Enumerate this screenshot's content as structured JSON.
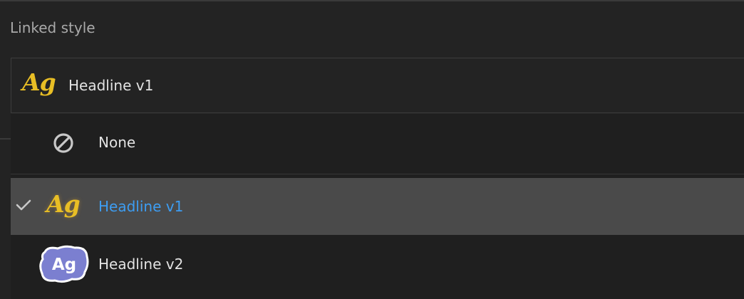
{
  "section": {
    "label": "Linked style"
  },
  "dropdown": {
    "icon": "Ag",
    "selected_value": "Headline v1"
  },
  "menu": {
    "items": [
      {
        "label": "None",
        "icon": "no-entry-icon",
        "selected": false
      },
      {
        "label": "Headline v1",
        "icon": "Ag",
        "selected": true
      },
      {
        "label": "Headline v2",
        "icon": "Ag",
        "selected": false
      }
    ]
  },
  "colors": {
    "background": "#232323",
    "menu_background": "#1f1f1f",
    "highlight": "#4a4a4a",
    "accent_blue": "#3d9df2",
    "serif_gold": "#e8be25",
    "bubble_purple": "#7b7fd0"
  }
}
